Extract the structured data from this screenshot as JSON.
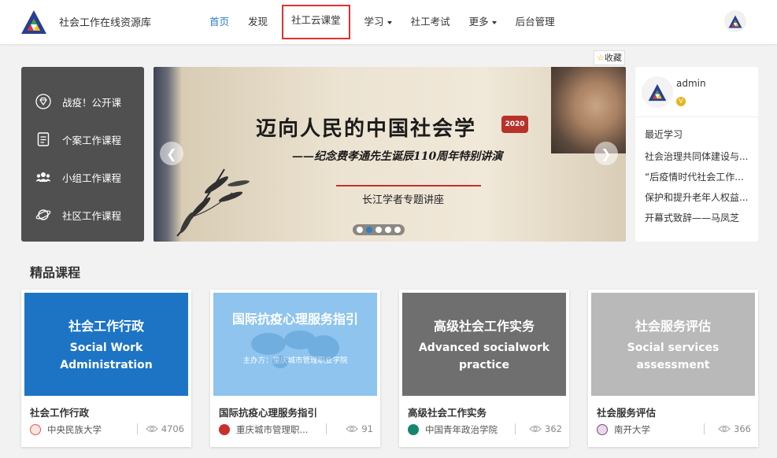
{
  "header": {
    "site_title": "社会工作在线资源库",
    "nav": [
      {
        "label": "首页",
        "active": true
      },
      {
        "label": "发现"
      },
      {
        "label": "社工云课堂",
        "highlighted": true
      },
      {
        "label": "学习",
        "dropdown": true
      },
      {
        "label": "社工考试"
      },
      {
        "label": "更多",
        "dropdown": true
      },
      {
        "label": "后台管理"
      }
    ],
    "accent_color": "#2d7fc5",
    "highlight_color": "#e2302d"
  },
  "side_menu": [
    {
      "label": "战疫！公开课",
      "icon": "diamond-icon"
    },
    {
      "label": "个案工作课程",
      "icon": "document-icon"
    },
    {
      "label": "小组工作课程",
      "icon": "group-icon"
    },
    {
      "label": "社区工作课程",
      "icon": "planet-icon"
    }
  ],
  "banner": {
    "title": "迈向人民的中国社会学",
    "seal": "2020",
    "subtitle": "——纪念费孝通先生诞辰110周年特别讲演",
    "lecture": "长江学者专题讲座",
    "favorite_label": "收藏",
    "slide_count": 5,
    "active_slide": 1
  },
  "user": {
    "name": "admin",
    "vip_badge": "V",
    "recent_title": "最近学习",
    "recent": [
      "社会治理共同体建设与...",
      "“后疫情时代社会工作...",
      "保护和提升老年人权益...",
      "开幕式致辞——马凤芝"
    ]
  },
  "section": {
    "title": "精品课程"
  },
  "courses": [
    {
      "cover_cn": "社会工作行政",
      "cover_en_1": "Social Work",
      "cover_en_2": "Administration",
      "cover_color": "#1d74c5",
      "name": "社会工作行政",
      "school": "中央民族大学",
      "views": "4706"
    },
    {
      "cover_cn": "国际抗疫心理服务指引",
      "cover_host": "主办方：重庆城市管理职业学院",
      "cover_color": "#8ec4ee",
      "name": "国际抗疫心理服务指引",
      "school": "重庆城市管理职...",
      "views": "91"
    },
    {
      "cover_cn": "高级社会工作实务",
      "cover_en_1": "Advanced socialwork",
      "cover_en_2": "practice",
      "cover_color": "#6f6f6f",
      "name": "高级社会工作实务",
      "school": "中国青年政治学院",
      "views": "362"
    },
    {
      "cover_cn": "社会服务评估",
      "cover_en_1": "Social services",
      "cover_en_2": "assessment",
      "cover_color": "#b9b9b9",
      "name": "社会服务评估",
      "school": "南开大学",
      "views": "366"
    }
  ]
}
